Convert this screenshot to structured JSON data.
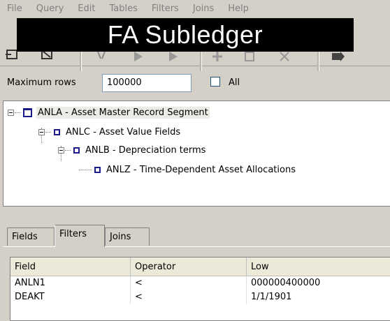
{
  "menu": [
    "File",
    "Query",
    "Edit",
    "Tables",
    "Filters",
    "Joins",
    "Help"
  ],
  "banner": {
    "title": "FA Subledger"
  },
  "max_rows": {
    "label": "Maximum rows",
    "value": "100000",
    "all_label": "All",
    "all_checked": false
  },
  "tree": {
    "nodes": [
      {
        "label": "ANLA - Asset Master Record Segment",
        "selected": true
      },
      {
        "label": "ANLC - Asset Value Fields"
      },
      {
        "label": "ANLB - Depreciation terms"
      },
      {
        "label": "ANLZ - Time-Dependent Asset Allocations"
      }
    ]
  },
  "tabs": [
    {
      "label": "Fields"
    },
    {
      "label": "Filters",
      "active": true
    },
    {
      "label": "Joins"
    }
  ],
  "grid": {
    "columns": [
      "Field",
      "Operator",
      "Low"
    ],
    "rows": [
      [
        "ANLN1",
        "<",
        "000000400000"
      ],
      [
        "DEAKT",
        "<",
        "1/1/1901"
      ]
    ]
  }
}
